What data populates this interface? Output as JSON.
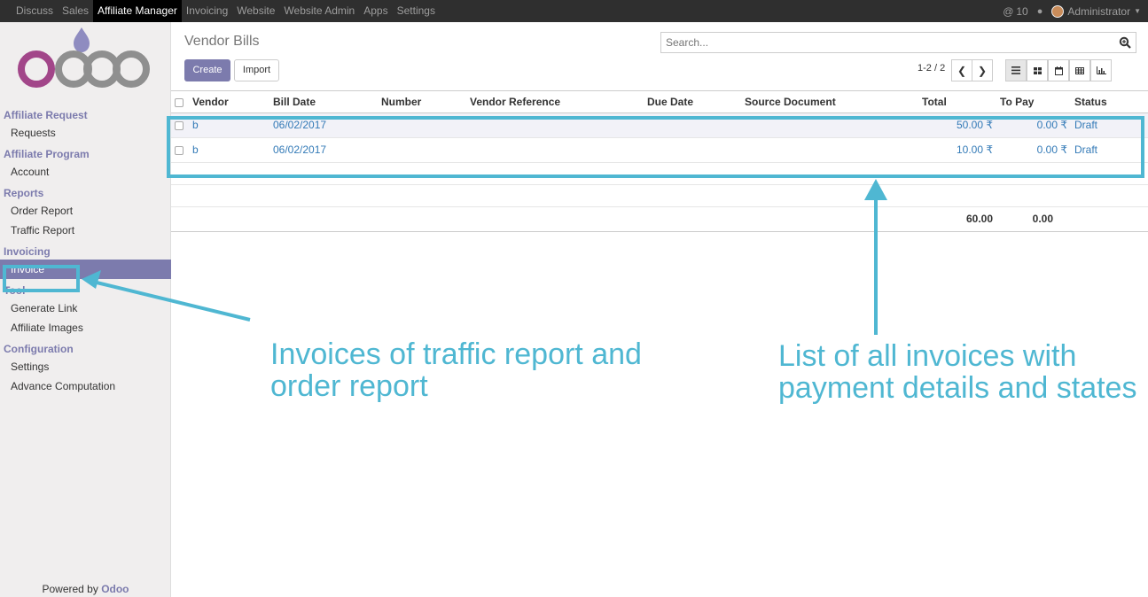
{
  "topbar": {
    "menu": [
      "Discuss",
      "Sales",
      "Affiliate Manager",
      "Invoicing",
      "Website",
      "Website Admin",
      "Apps",
      "Settings"
    ],
    "active_menu": "Affiliate Manager",
    "notifications": "10",
    "user": "Administrator"
  },
  "sidebar": {
    "sections": [
      {
        "title": "Affiliate Request",
        "items": [
          "Requests"
        ]
      },
      {
        "title": "Affiliate Program",
        "items": [
          "Account"
        ]
      },
      {
        "title": "Reports",
        "items": [
          "Order Report",
          "Traffic Report"
        ]
      },
      {
        "title": "Invoicing",
        "items": [
          "Invoice"
        ]
      },
      {
        "title": "Tool",
        "items": [
          "Generate Link",
          "Affiliate Images"
        ]
      },
      {
        "title": "Configuration",
        "items": [
          "Settings",
          "Advance Computation"
        ]
      }
    ],
    "active_item": "Invoice",
    "powered_prefix": "Powered by",
    "powered_brand": "Odoo"
  },
  "control_panel": {
    "title": "Vendor Bills",
    "create_label": "Create",
    "import_label": "Import",
    "search_placeholder": "Search...",
    "pager": "1-2 / 2"
  },
  "table": {
    "headers": [
      "Vendor",
      "Bill Date",
      "Number",
      "Vendor Reference",
      "Due Date",
      "Source Document",
      "Total",
      "To Pay",
      "Status"
    ],
    "rows": [
      {
        "vendor": "b",
        "bill_date": "06/02/2017",
        "number": "",
        "vendor_ref": "",
        "due_date": "",
        "source": "",
        "total": "50.00 ₹",
        "to_pay": "0.00 ₹",
        "status": "Draft"
      },
      {
        "vendor": "b",
        "bill_date": "06/02/2017",
        "number": "",
        "vendor_ref": "",
        "due_date": "",
        "source": "",
        "total": "10.00 ₹",
        "to_pay": "0.00 ₹",
        "status": "Draft"
      }
    ],
    "sum_total": "60.00",
    "sum_to_pay": "0.00"
  },
  "annotations": {
    "left_line1": "Invoices of traffic report and",
    "left_line2": "order report",
    "right_line1": "List of all invoices with",
    "right_line2": "payment details and states",
    "color": "#4fb7d2"
  }
}
